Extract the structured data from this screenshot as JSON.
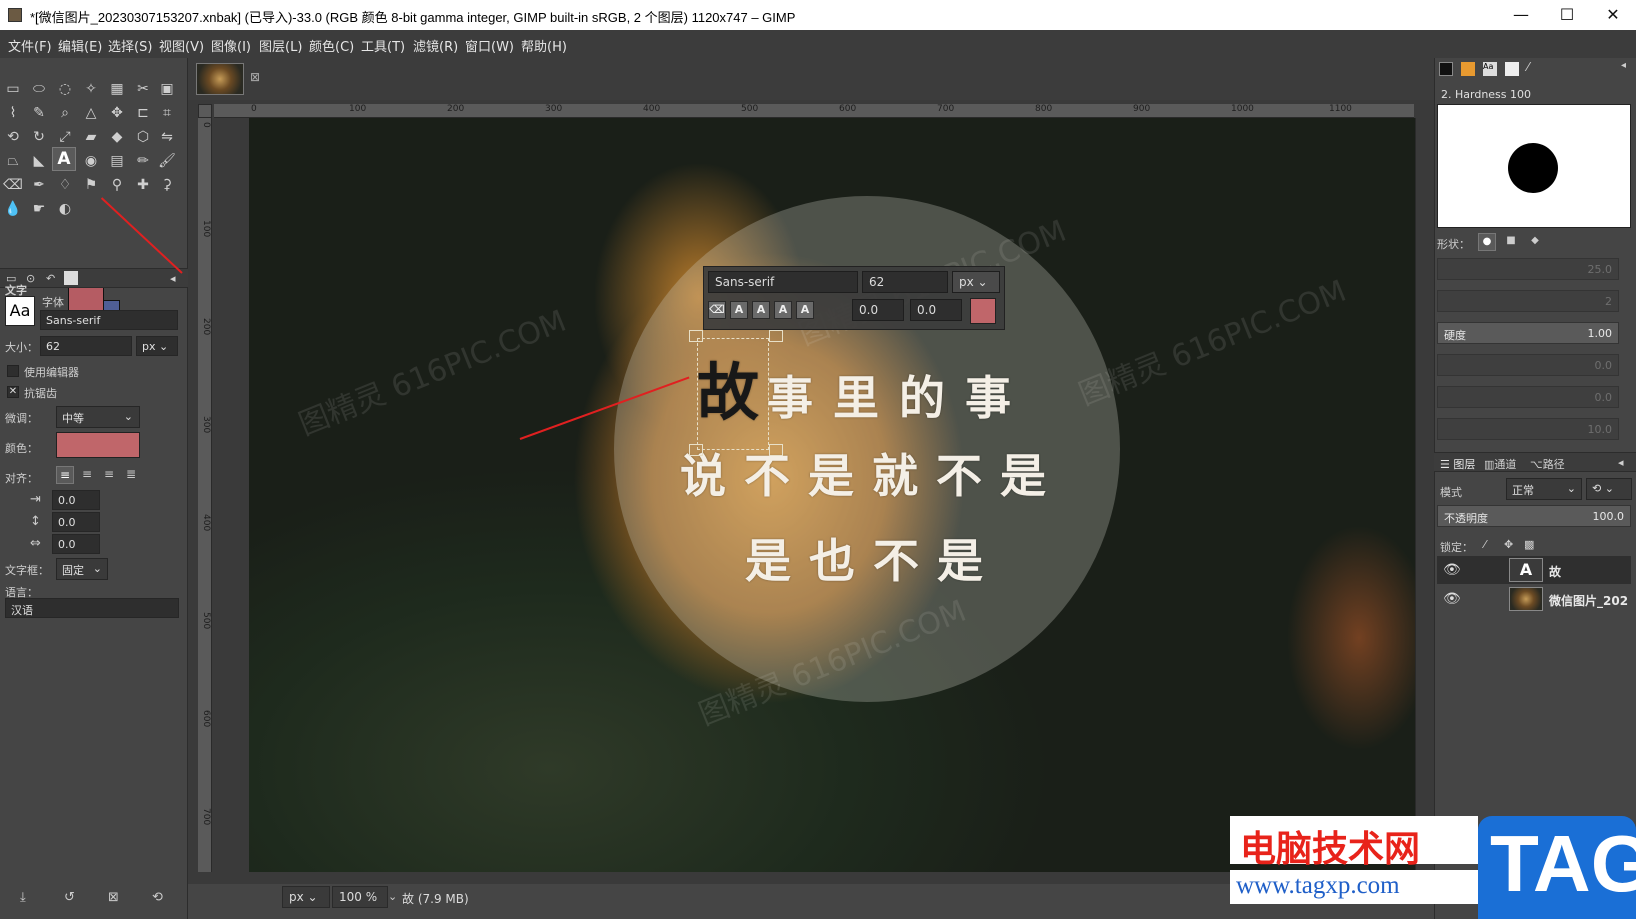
{
  "titlebar": {
    "title": "*[微信图片_20230307153207.xnbak] (已导入)-33.0 (RGB 颜色 8-bit gamma integer, GIMP built-in sRGB, 2 个图层) 1120x747 – GIMP",
    "minimize": "—",
    "maximize": "☐",
    "close": "✕"
  },
  "menu": [
    "文件(F)",
    "编辑(E)",
    "选择(S)",
    "视图(V)",
    "图像(I)",
    "图层(L)",
    "颜色(C)",
    "工具(T)",
    "滤镜(R)",
    "窗口(W)",
    "帮助(H)"
  ],
  "tool_options": {
    "title": "文字",
    "font_label": "字体",
    "font_value": "Sans-serif",
    "font_preview": "Aa",
    "size_label": "大小：",
    "size_value": "62",
    "size_unit": "px",
    "use_editor": "使用编辑器",
    "antialias": "抗锯齿",
    "hinting_label": "微调：",
    "hinting_value": "中等",
    "color_label": "颜色：",
    "color": "#c0666a",
    "justify_label": "对齐：",
    "indent_value": "0.0",
    "line_spacing_value": "0.0",
    "letter_spacing_value": "0.0",
    "box_label": "文字框：",
    "box_value": "固定",
    "language_label": "语言：",
    "language_value": "汉语"
  },
  "colors": {
    "foreground": "#b55c63",
    "background": "#4f5e96"
  },
  "ruler": {
    "labels": [
      "0",
      "100",
      "200",
      "300",
      "400",
      "500",
      "600",
      "700",
      "800",
      "900",
      "1000",
      "1100"
    ],
    "v_labels": [
      "0",
      "100",
      "200",
      "300",
      "400",
      "500",
      "600",
      "700"
    ]
  },
  "canvas": {
    "line1_first": "故",
    "line1_rest": "事里的事",
    "line2": "说不是就不是",
    "line3": "是也不是",
    "watermark": "图精灵 616PIC.COM"
  },
  "text_overlay": {
    "font": "Sans-serif",
    "size": "62",
    "unit": "px",
    "baseline": "0.0",
    "kerning": "0.0",
    "color": "#c0666a"
  },
  "statusbar": {
    "unit": "px",
    "zoom": "100 %",
    "info": "故 (7.9 MB)"
  },
  "brushes": {
    "name": "2. Hardness 100",
    "shape_label": "形状：",
    "hardness_label": "硬度",
    "hardness_value": "1.00",
    "dim_values": [
      "25.0",
      "2",
      "0.0",
      "0.0",
      "10.0"
    ]
  },
  "layers": {
    "tabs": [
      "图层",
      "通道",
      "路径"
    ],
    "mode_label": "模式",
    "mode_value": "正常",
    "opacity_label": "不透明度",
    "opacity_value": "100.0",
    "lock_label": "锁定：",
    "items": [
      {
        "name": "故"
      },
      {
        "name": "微信图片_202"
      }
    ]
  },
  "brand_watermark": {
    "cn": "电脑技术网",
    "url": "www.tagxp.com",
    "tag": "TAG"
  }
}
